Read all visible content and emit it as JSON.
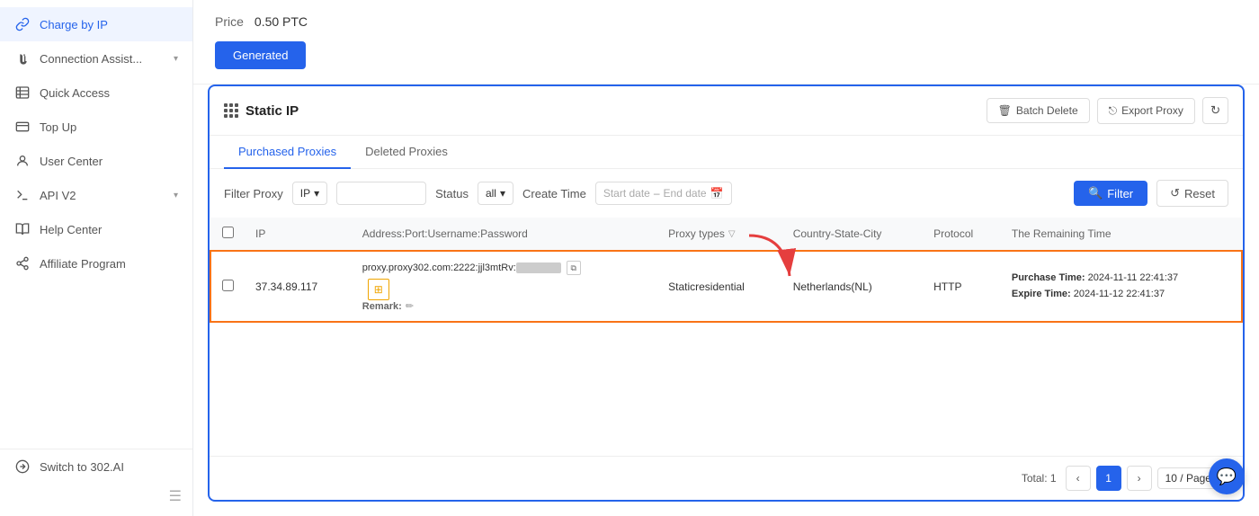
{
  "sidebar": {
    "items": [
      {
        "id": "charge-by-ip",
        "label": "Charge by IP",
        "active": true,
        "icon": "link-icon",
        "hasChevron": false
      },
      {
        "id": "connection-assist",
        "label": "Connection Assist...",
        "active": false,
        "icon": "plug-icon",
        "hasChevron": true
      },
      {
        "id": "quick-access",
        "label": "Quick Access",
        "active": false,
        "icon": "flash-icon",
        "hasChevron": false
      },
      {
        "id": "top-up",
        "label": "Top Up",
        "active": false,
        "icon": "wallet-icon",
        "hasChevron": false
      },
      {
        "id": "user-center",
        "label": "User Center",
        "active": false,
        "icon": "user-icon",
        "hasChevron": false
      },
      {
        "id": "api-v2",
        "label": "API V2",
        "active": false,
        "icon": "api-icon",
        "hasChevron": true
      },
      {
        "id": "help-center",
        "label": "Help Center",
        "active": false,
        "icon": "book-icon",
        "hasChevron": false
      },
      {
        "id": "affiliate-program",
        "label": "Affiliate Program",
        "active": false,
        "icon": "share-icon",
        "hasChevron": false
      }
    ],
    "bottom_item": {
      "id": "switch-to-302",
      "label": "Switch to 302.AI",
      "icon": "switch-icon"
    }
  },
  "header": {
    "price_label": "Price",
    "price_value": "0.50 PTC",
    "generated_button": "Generated"
  },
  "panel": {
    "title": "Static IP",
    "batch_delete_label": "Batch Delete",
    "export_proxy_label": "Export Proxy",
    "tabs": [
      {
        "id": "purchased",
        "label": "Purchased Proxies",
        "active": true
      },
      {
        "id": "deleted",
        "label": "Deleted Proxies",
        "active": false
      }
    ],
    "filter": {
      "filter_proxy_label": "Filter Proxy",
      "filter_type": "IP",
      "status_label": "Status",
      "status_value": "all",
      "create_time_label": "Create Time",
      "start_date_placeholder": "Start date",
      "end_date_placeholder": "End date",
      "filter_button": "Filter",
      "reset_button": "Reset"
    },
    "table": {
      "columns": [
        "",
        "IP",
        "Address:Port:Username:Password",
        "Proxy types",
        "Country-State-City",
        "Protocol",
        "The Remaining Time"
      ],
      "rows": [
        {
          "ip": "37.34.89.117",
          "address": "proxy.proxy302.com:2222:jjl3mtRv:",
          "address_blurred": "████████",
          "proxy_type": "Staticresidential",
          "country": "Netherlands(NL)",
          "protocol": "HTTP",
          "purchase_time_label": "Purchase Time:",
          "purchase_time": "2024-11-11 22:41:37",
          "expire_time_label": "Expire Time:",
          "expire_time": "2024-11-12 22:41:37",
          "remark_label": "Remark:",
          "highlighted": true
        }
      ]
    },
    "pagination": {
      "total_label": "Total:",
      "total_count": "1",
      "current_page": "1",
      "page_size": "10 / Page"
    }
  }
}
